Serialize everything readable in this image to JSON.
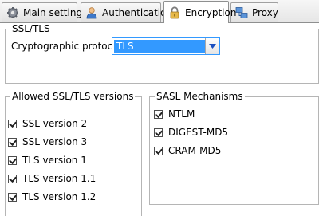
{
  "tabs": [
    {
      "label": "Main settings",
      "icon": "gear-icon"
    },
    {
      "label": "Authentication",
      "icon": "user-icon"
    },
    {
      "label": "Encryption",
      "icon": "lock-icon"
    },
    {
      "label": "Proxy",
      "icon": "network-icon"
    }
  ],
  "active_tab": "Encryption",
  "ssl_group": {
    "title": "SSL/TLS",
    "protocol_label": "Cryptographic protocol:",
    "protocol_value": "TLS"
  },
  "versions_group": {
    "title": "Allowed SSL/TLS versions",
    "items": [
      {
        "label": "SSL version 2",
        "checked": true
      },
      {
        "label": "SSL version 3",
        "checked": true
      },
      {
        "label": "TLS version 1",
        "checked": true
      },
      {
        "label": "TLS version 1.1",
        "checked": true
      },
      {
        "label": "TLS version 1.2",
        "checked": true
      }
    ]
  },
  "sasl_group": {
    "title": "SASL Mechanisms",
    "items": [
      {
        "label": "NTLM",
        "checked": true
      },
      {
        "label": "DIGEST-MD5",
        "checked": true
      },
      {
        "label": "CRAM-MD5",
        "checked": true
      }
    ]
  },
  "colors": {
    "selection": "#3399ff",
    "border": "#b5b5b5",
    "dropdown_arrow": "#1a4fbf"
  }
}
